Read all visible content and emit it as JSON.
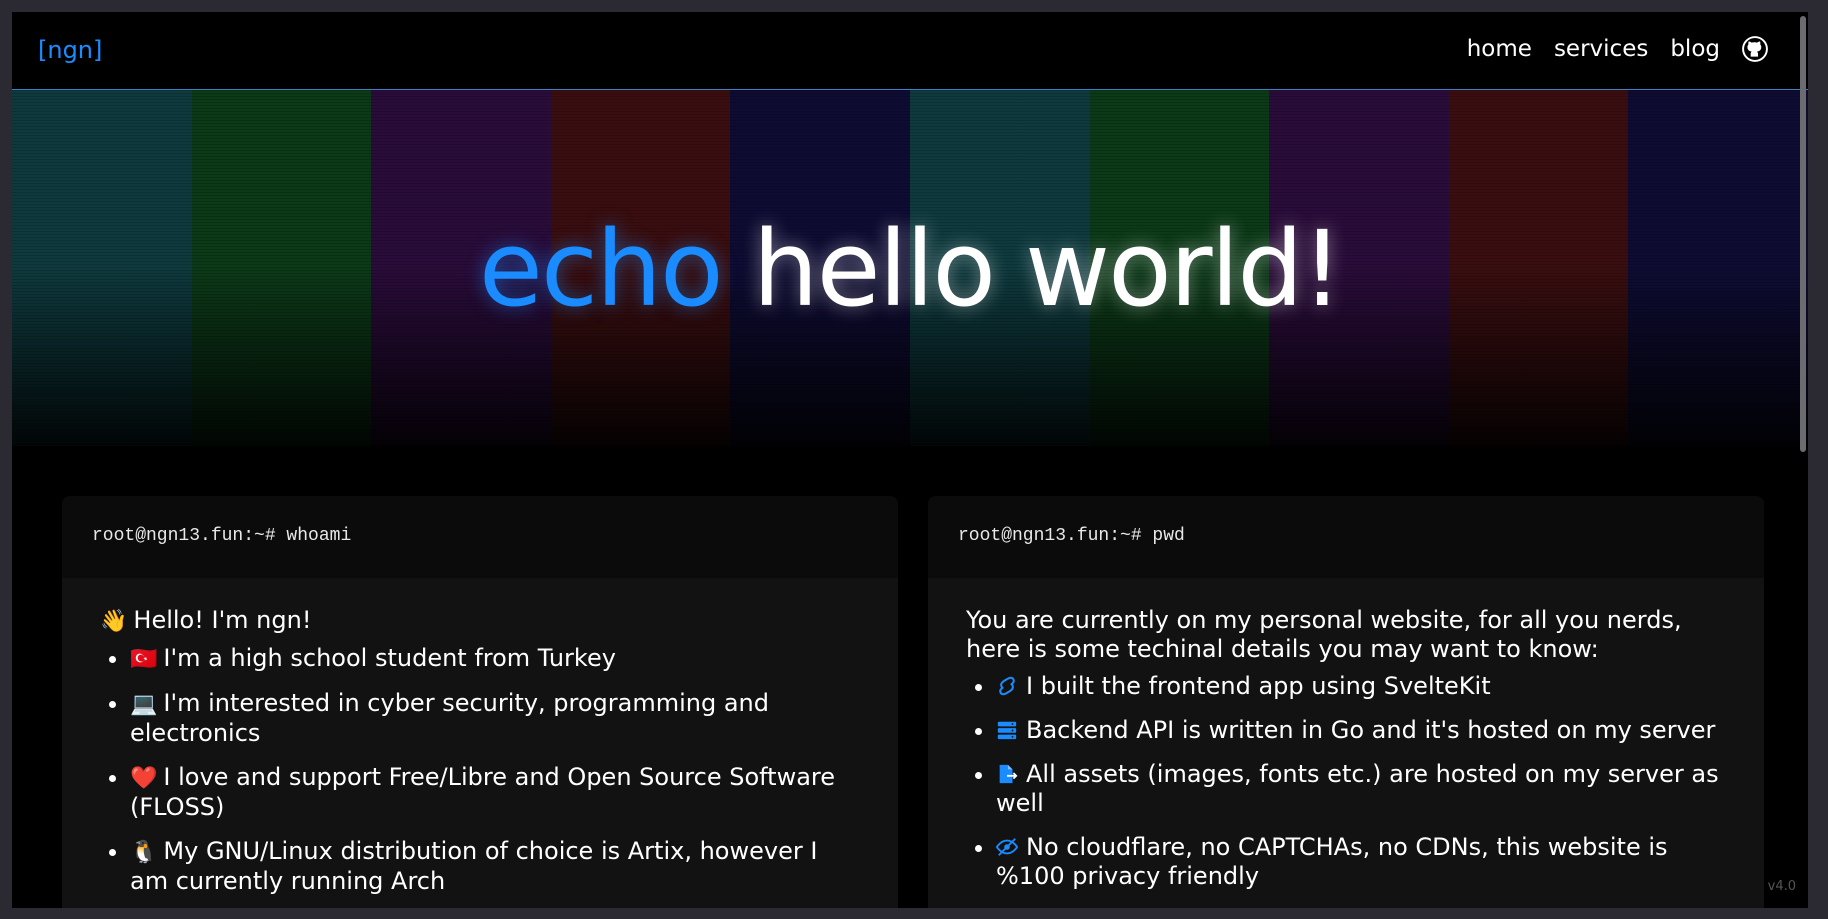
{
  "nav": {
    "brand": "[ngn]",
    "links": [
      "home",
      "services",
      "blog"
    ]
  },
  "hero": {
    "keyword": "echo",
    "rest": "hello world!",
    "stripe_colors": [
      "#0e3a3e",
      "#0c3a18",
      "#2a0c3a",
      "#3a0e10",
      "#0e0c33",
      "#0e3a3e",
      "#0c3a18",
      "#2a0c3a",
      "#3a0e10",
      "#0e0c33"
    ]
  },
  "cards": {
    "whoami": {
      "prompt": "root@ngn13.fun:~# whoami",
      "intro": "Hello! I'm ngn!",
      "intro_emoji": "👋",
      "items": [
        {
          "emoji": "🇹🇷",
          "text": "I'm a high school student from Turkey"
        },
        {
          "emoji": "💻",
          "text": "I'm interested in cyber security, programming and electronics"
        },
        {
          "emoji": "❤️",
          "text": "I love and support Free/Libre and Open Source Software (FLOSS)"
        },
        {
          "emoji": "🐧",
          "text": "My GNU/Linux distribution of choice is Artix, however I am currently running Arch"
        }
      ]
    },
    "pwd": {
      "prompt": "root@ngn13.fun:~# pwd",
      "intro": "You are currently on my personal website, for all you nerds, here is some techinal details you may want to know:",
      "items": [
        {
          "icon": "svelte-icon",
          "text": "I built the frontend app using SvelteKit"
        },
        {
          "icon": "server-icon",
          "text": "Backend API is written in Go and it's hosted on my server"
        },
        {
          "icon": "file-export-icon",
          "text": "All assets (images, fonts etc.) are hosted on my server as well"
        },
        {
          "icon": "eye-slash-icon",
          "text": "No cloudflare, no CAPTCHAs, no CDNs, this website is %100 privacy friendly"
        }
      ]
    }
  },
  "footer": {
    "version": "v4.0"
  },
  "colors": {
    "accent": "#1a8cff",
    "card_bg": "#121212",
    "card_head_bg": "#0b0b0b"
  }
}
